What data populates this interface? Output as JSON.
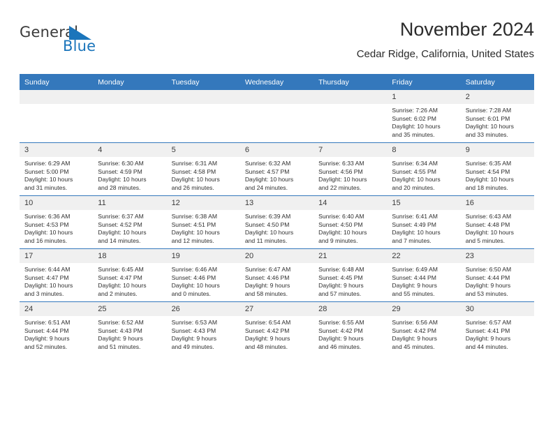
{
  "brand": {
    "name_part1": "General",
    "name_part2": "Blue",
    "accent_color": "#1b75bb",
    "header_color": "#3478bc"
  },
  "header": {
    "title": "November 2024",
    "subtitle": "Cedar Ridge, California, United States"
  },
  "weekdays": [
    "Sunday",
    "Monday",
    "Tuesday",
    "Wednesday",
    "Thursday",
    "Friday",
    "Saturday"
  ],
  "labels": {
    "sunrise_prefix": "Sunrise: ",
    "sunset_prefix": "Sunset: ",
    "daylight_prefix": "Daylight: "
  },
  "weeks": [
    [
      {
        "day": "",
        "sunrise": "",
        "sunset": "",
        "daylight_line1": "",
        "daylight_line2": ""
      },
      {
        "day": "",
        "sunrise": "",
        "sunset": "",
        "daylight_line1": "",
        "daylight_line2": ""
      },
      {
        "day": "",
        "sunrise": "",
        "sunset": "",
        "daylight_line1": "",
        "daylight_line2": ""
      },
      {
        "day": "",
        "sunrise": "",
        "sunset": "",
        "daylight_line1": "",
        "daylight_line2": ""
      },
      {
        "day": "",
        "sunrise": "",
        "sunset": "",
        "daylight_line1": "",
        "daylight_line2": ""
      },
      {
        "day": "1",
        "sunrise": "Sunrise: 7:26 AM",
        "sunset": "Sunset: 6:02 PM",
        "daylight_line1": "Daylight: 10 hours",
        "daylight_line2": "and 35 minutes."
      },
      {
        "day": "2",
        "sunrise": "Sunrise: 7:28 AM",
        "sunset": "Sunset: 6:01 PM",
        "daylight_line1": "Daylight: 10 hours",
        "daylight_line2": "and 33 minutes."
      }
    ],
    [
      {
        "day": "3",
        "sunrise": "Sunrise: 6:29 AM",
        "sunset": "Sunset: 5:00 PM",
        "daylight_line1": "Daylight: 10 hours",
        "daylight_line2": "and 31 minutes."
      },
      {
        "day": "4",
        "sunrise": "Sunrise: 6:30 AM",
        "sunset": "Sunset: 4:59 PM",
        "daylight_line1": "Daylight: 10 hours",
        "daylight_line2": "and 28 minutes."
      },
      {
        "day": "5",
        "sunrise": "Sunrise: 6:31 AM",
        "sunset": "Sunset: 4:58 PM",
        "daylight_line1": "Daylight: 10 hours",
        "daylight_line2": "and 26 minutes."
      },
      {
        "day": "6",
        "sunrise": "Sunrise: 6:32 AM",
        "sunset": "Sunset: 4:57 PM",
        "daylight_line1": "Daylight: 10 hours",
        "daylight_line2": "and 24 minutes."
      },
      {
        "day": "7",
        "sunrise": "Sunrise: 6:33 AM",
        "sunset": "Sunset: 4:56 PM",
        "daylight_line1": "Daylight: 10 hours",
        "daylight_line2": "and 22 minutes."
      },
      {
        "day": "8",
        "sunrise": "Sunrise: 6:34 AM",
        "sunset": "Sunset: 4:55 PM",
        "daylight_line1": "Daylight: 10 hours",
        "daylight_line2": "and 20 minutes."
      },
      {
        "day": "9",
        "sunrise": "Sunrise: 6:35 AM",
        "sunset": "Sunset: 4:54 PM",
        "daylight_line1": "Daylight: 10 hours",
        "daylight_line2": "and 18 minutes."
      }
    ],
    [
      {
        "day": "10",
        "sunrise": "Sunrise: 6:36 AM",
        "sunset": "Sunset: 4:53 PM",
        "daylight_line1": "Daylight: 10 hours",
        "daylight_line2": "and 16 minutes."
      },
      {
        "day": "11",
        "sunrise": "Sunrise: 6:37 AM",
        "sunset": "Sunset: 4:52 PM",
        "daylight_line1": "Daylight: 10 hours",
        "daylight_line2": "and 14 minutes."
      },
      {
        "day": "12",
        "sunrise": "Sunrise: 6:38 AM",
        "sunset": "Sunset: 4:51 PM",
        "daylight_line1": "Daylight: 10 hours",
        "daylight_line2": "and 12 minutes."
      },
      {
        "day": "13",
        "sunrise": "Sunrise: 6:39 AM",
        "sunset": "Sunset: 4:50 PM",
        "daylight_line1": "Daylight: 10 hours",
        "daylight_line2": "and 11 minutes."
      },
      {
        "day": "14",
        "sunrise": "Sunrise: 6:40 AM",
        "sunset": "Sunset: 4:50 PM",
        "daylight_line1": "Daylight: 10 hours",
        "daylight_line2": "and 9 minutes."
      },
      {
        "day": "15",
        "sunrise": "Sunrise: 6:41 AM",
        "sunset": "Sunset: 4:49 PM",
        "daylight_line1": "Daylight: 10 hours",
        "daylight_line2": "and 7 minutes."
      },
      {
        "day": "16",
        "sunrise": "Sunrise: 6:43 AM",
        "sunset": "Sunset: 4:48 PM",
        "daylight_line1": "Daylight: 10 hours",
        "daylight_line2": "and 5 minutes."
      }
    ],
    [
      {
        "day": "17",
        "sunrise": "Sunrise: 6:44 AM",
        "sunset": "Sunset: 4:47 PM",
        "daylight_line1": "Daylight: 10 hours",
        "daylight_line2": "and 3 minutes."
      },
      {
        "day": "18",
        "sunrise": "Sunrise: 6:45 AM",
        "sunset": "Sunset: 4:47 PM",
        "daylight_line1": "Daylight: 10 hours",
        "daylight_line2": "and 2 minutes."
      },
      {
        "day": "19",
        "sunrise": "Sunrise: 6:46 AM",
        "sunset": "Sunset: 4:46 PM",
        "daylight_line1": "Daylight: 10 hours",
        "daylight_line2": "and 0 minutes."
      },
      {
        "day": "20",
        "sunrise": "Sunrise: 6:47 AM",
        "sunset": "Sunset: 4:46 PM",
        "daylight_line1": "Daylight: 9 hours",
        "daylight_line2": "and 58 minutes."
      },
      {
        "day": "21",
        "sunrise": "Sunrise: 6:48 AM",
        "sunset": "Sunset: 4:45 PM",
        "daylight_line1": "Daylight: 9 hours",
        "daylight_line2": "and 57 minutes."
      },
      {
        "day": "22",
        "sunrise": "Sunrise: 6:49 AM",
        "sunset": "Sunset: 4:44 PM",
        "daylight_line1": "Daylight: 9 hours",
        "daylight_line2": "and 55 minutes."
      },
      {
        "day": "23",
        "sunrise": "Sunrise: 6:50 AM",
        "sunset": "Sunset: 4:44 PM",
        "daylight_line1": "Daylight: 9 hours",
        "daylight_line2": "and 53 minutes."
      }
    ],
    [
      {
        "day": "24",
        "sunrise": "Sunrise: 6:51 AM",
        "sunset": "Sunset: 4:44 PM",
        "daylight_line1": "Daylight: 9 hours",
        "daylight_line2": "and 52 minutes."
      },
      {
        "day": "25",
        "sunrise": "Sunrise: 6:52 AM",
        "sunset": "Sunset: 4:43 PM",
        "daylight_line1": "Daylight: 9 hours",
        "daylight_line2": "and 51 minutes."
      },
      {
        "day": "26",
        "sunrise": "Sunrise: 6:53 AM",
        "sunset": "Sunset: 4:43 PM",
        "daylight_line1": "Daylight: 9 hours",
        "daylight_line2": "and 49 minutes."
      },
      {
        "day": "27",
        "sunrise": "Sunrise: 6:54 AM",
        "sunset": "Sunset: 4:42 PM",
        "daylight_line1": "Daylight: 9 hours",
        "daylight_line2": "and 48 minutes."
      },
      {
        "day": "28",
        "sunrise": "Sunrise: 6:55 AM",
        "sunset": "Sunset: 4:42 PM",
        "daylight_line1": "Daylight: 9 hours",
        "daylight_line2": "and 46 minutes."
      },
      {
        "day": "29",
        "sunrise": "Sunrise: 6:56 AM",
        "sunset": "Sunset: 4:42 PM",
        "daylight_line1": "Daylight: 9 hours",
        "daylight_line2": "and 45 minutes."
      },
      {
        "day": "30",
        "sunrise": "Sunrise: 6:57 AM",
        "sunset": "Sunset: 4:41 PM",
        "daylight_line1": "Daylight: 9 hours",
        "daylight_line2": "and 44 minutes."
      }
    ]
  ]
}
